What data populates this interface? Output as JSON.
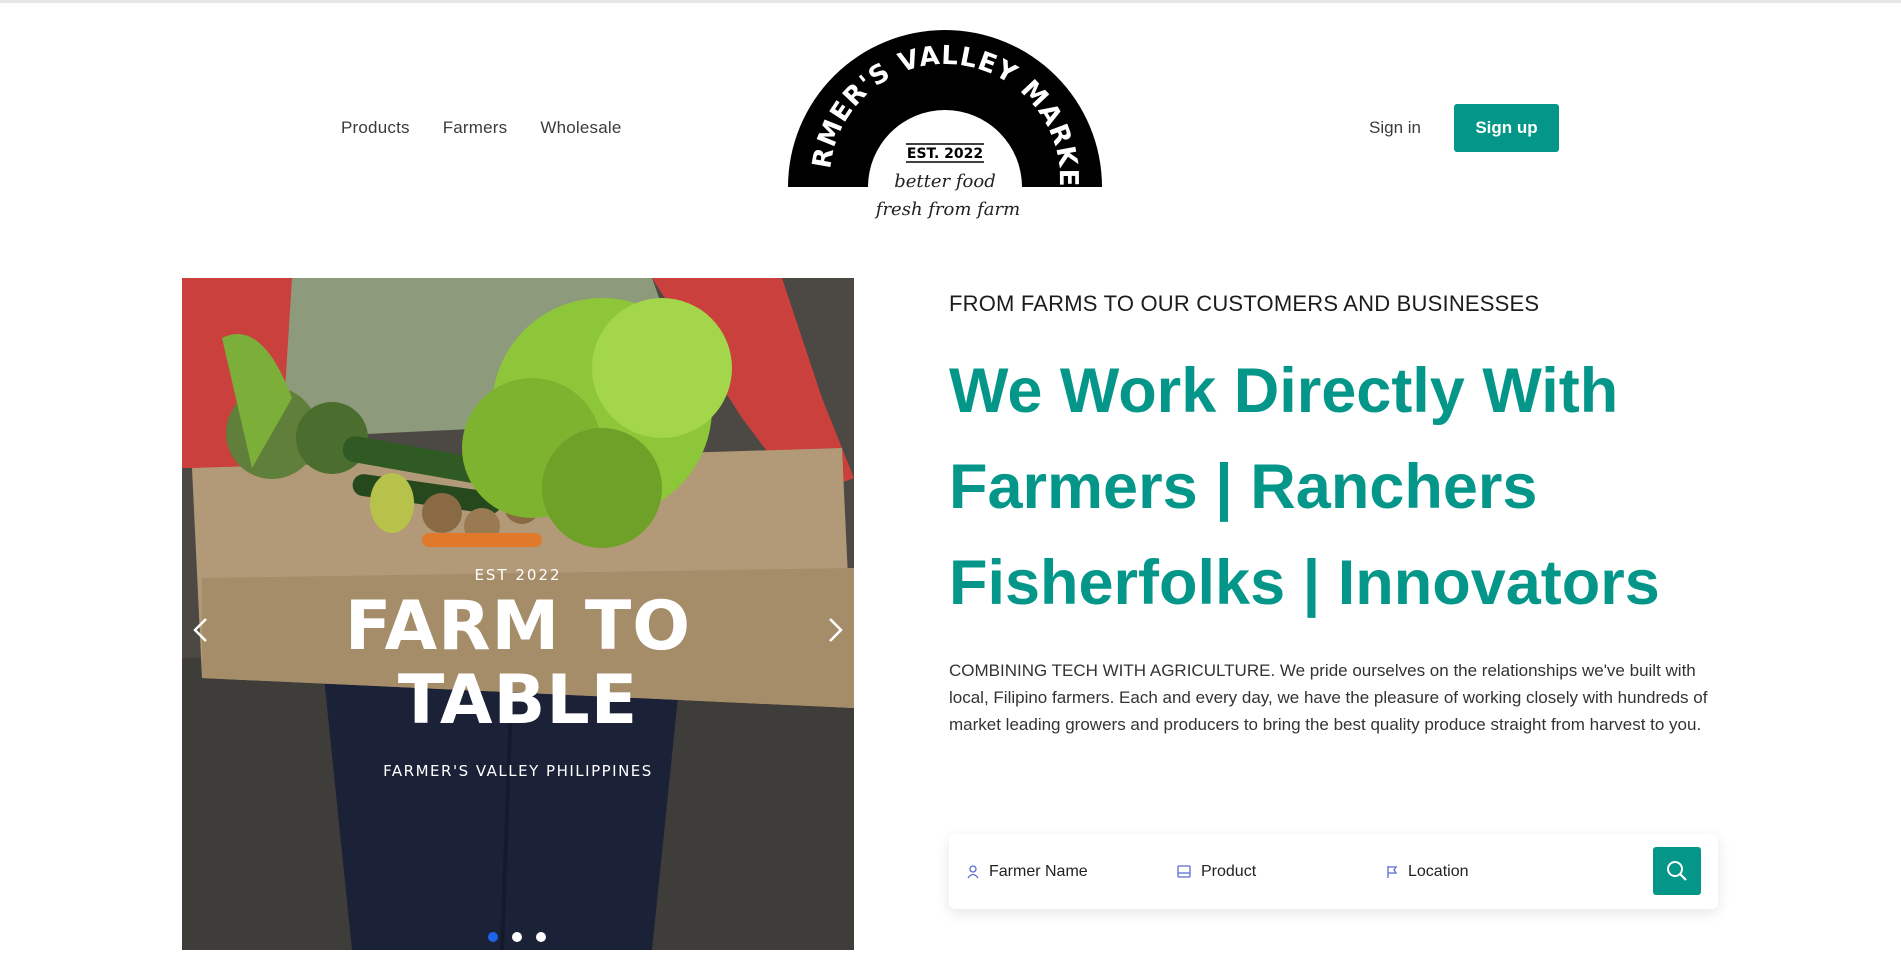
{
  "nav": {
    "left": [
      "Products",
      "Farmers",
      "Wholesale"
    ],
    "signin": "Sign in",
    "signup": "Sign up"
  },
  "logo": {
    "arc_text": "FARMER'S VALLEY MARKET",
    "est": "EST. 2022",
    "tagline_1": "better food",
    "tagline_2": "fresh from farm"
  },
  "hero": {
    "est": "EST 2022",
    "title_line1": "FARM TO",
    "title_line2": "TABLE",
    "subtitle": "FARMER'S VALLEY PHILIPPINES",
    "slides": 3,
    "active_slide": 1
  },
  "content": {
    "eyebrow": "FROM FARMS TO OUR CUSTOMERS AND BUSINESSES",
    "headline": [
      "We Work Directly With",
      "Farmers | Ranchers",
      "Fisherfolks | Innovators"
    ],
    "description": "COMBINING TECH WITH AGRICULTURE. We pride ourselves on the relationships we've built with local, Filipino farmers. Each and every day, we have the pleasure of working closely with hundreds of market leading growers and producers to bring the best quality produce straight from harvest to you."
  },
  "search": {
    "farmer": "Farmer Name",
    "product": "Product",
    "location": "Location",
    "farmer_icon": "user-icon",
    "product_icon": "box-icon",
    "location_icon": "flag-icon",
    "button_icon": "search-icon"
  },
  "colors": {
    "brand": "#049789",
    "active_dot": "#1e63e9"
  }
}
